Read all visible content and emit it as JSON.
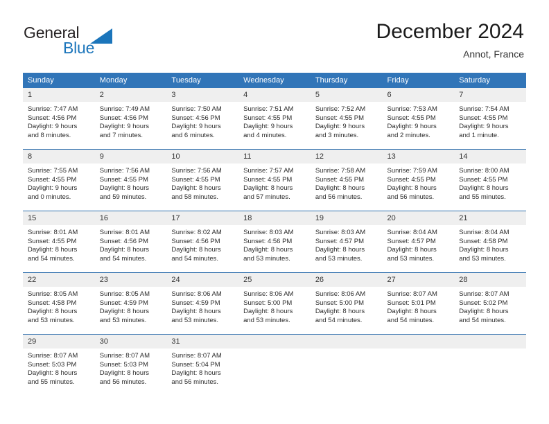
{
  "brand": {
    "word1": "General",
    "word2": "Blue",
    "colors": {
      "dark": "#231f20",
      "blue": "#1b75bb"
    },
    "triangle_icon": "triangle-icon"
  },
  "header": {
    "title": "December 2024",
    "subtitle": "Annot, France"
  },
  "theme": {
    "header_blue": "#3175b8",
    "row_divider": "#2f6fad",
    "daynum_background": "#efefef",
    "text": "#2b2b2b"
  },
  "weekdays": [
    "Sunday",
    "Monday",
    "Tuesday",
    "Wednesday",
    "Thursday",
    "Friday",
    "Saturday"
  ],
  "weeks": [
    [
      {
        "day": "1",
        "sunrise": "Sunrise: 7:47 AM",
        "sunset": "Sunset: 4:56 PM",
        "daylight1": "Daylight: 9 hours",
        "daylight2": "and 8 minutes."
      },
      {
        "day": "2",
        "sunrise": "Sunrise: 7:49 AM",
        "sunset": "Sunset: 4:56 PM",
        "daylight1": "Daylight: 9 hours",
        "daylight2": "and 7 minutes."
      },
      {
        "day": "3",
        "sunrise": "Sunrise: 7:50 AM",
        "sunset": "Sunset: 4:56 PM",
        "daylight1": "Daylight: 9 hours",
        "daylight2": "and 6 minutes."
      },
      {
        "day": "4",
        "sunrise": "Sunrise: 7:51 AM",
        "sunset": "Sunset: 4:55 PM",
        "daylight1": "Daylight: 9 hours",
        "daylight2": "and 4 minutes."
      },
      {
        "day": "5",
        "sunrise": "Sunrise: 7:52 AM",
        "sunset": "Sunset: 4:55 PM",
        "daylight1": "Daylight: 9 hours",
        "daylight2": "and 3 minutes."
      },
      {
        "day": "6",
        "sunrise": "Sunrise: 7:53 AM",
        "sunset": "Sunset: 4:55 PM",
        "daylight1": "Daylight: 9 hours",
        "daylight2": "and 2 minutes."
      },
      {
        "day": "7",
        "sunrise": "Sunrise: 7:54 AM",
        "sunset": "Sunset: 4:55 PM",
        "daylight1": "Daylight: 9 hours",
        "daylight2": "and 1 minute."
      }
    ],
    [
      {
        "day": "8",
        "sunrise": "Sunrise: 7:55 AM",
        "sunset": "Sunset: 4:55 PM",
        "daylight1": "Daylight: 9 hours",
        "daylight2": "and 0 minutes."
      },
      {
        "day": "9",
        "sunrise": "Sunrise: 7:56 AM",
        "sunset": "Sunset: 4:55 PM",
        "daylight1": "Daylight: 8 hours",
        "daylight2": "and 59 minutes."
      },
      {
        "day": "10",
        "sunrise": "Sunrise: 7:56 AM",
        "sunset": "Sunset: 4:55 PM",
        "daylight1": "Daylight: 8 hours",
        "daylight2": "and 58 minutes."
      },
      {
        "day": "11",
        "sunrise": "Sunrise: 7:57 AM",
        "sunset": "Sunset: 4:55 PM",
        "daylight1": "Daylight: 8 hours",
        "daylight2": "and 57 minutes."
      },
      {
        "day": "12",
        "sunrise": "Sunrise: 7:58 AM",
        "sunset": "Sunset: 4:55 PM",
        "daylight1": "Daylight: 8 hours",
        "daylight2": "and 56 minutes."
      },
      {
        "day": "13",
        "sunrise": "Sunrise: 7:59 AM",
        "sunset": "Sunset: 4:55 PM",
        "daylight1": "Daylight: 8 hours",
        "daylight2": "and 56 minutes."
      },
      {
        "day": "14",
        "sunrise": "Sunrise: 8:00 AM",
        "sunset": "Sunset: 4:55 PM",
        "daylight1": "Daylight: 8 hours",
        "daylight2": "and 55 minutes."
      }
    ],
    [
      {
        "day": "15",
        "sunrise": "Sunrise: 8:01 AM",
        "sunset": "Sunset: 4:55 PM",
        "daylight1": "Daylight: 8 hours",
        "daylight2": "and 54 minutes."
      },
      {
        "day": "16",
        "sunrise": "Sunrise: 8:01 AM",
        "sunset": "Sunset: 4:56 PM",
        "daylight1": "Daylight: 8 hours",
        "daylight2": "and 54 minutes."
      },
      {
        "day": "17",
        "sunrise": "Sunrise: 8:02 AM",
        "sunset": "Sunset: 4:56 PM",
        "daylight1": "Daylight: 8 hours",
        "daylight2": "and 54 minutes."
      },
      {
        "day": "18",
        "sunrise": "Sunrise: 8:03 AM",
        "sunset": "Sunset: 4:56 PM",
        "daylight1": "Daylight: 8 hours",
        "daylight2": "and 53 minutes."
      },
      {
        "day": "19",
        "sunrise": "Sunrise: 8:03 AM",
        "sunset": "Sunset: 4:57 PM",
        "daylight1": "Daylight: 8 hours",
        "daylight2": "and 53 minutes."
      },
      {
        "day": "20",
        "sunrise": "Sunrise: 8:04 AM",
        "sunset": "Sunset: 4:57 PM",
        "daylight1": "Daylight: 8 hours",
        "daylight2": "and 53 minutes."
      },
      {
        "day": "21",
        "sunrise": "Sunrise: 8:04 AM",
        "sunset": "Sunset: 4:58 PM",
        "daylight1": "Daylight: 8 hours",
        "daylight2": "and 53 minutes."
      }
    ],
    [
      {
        "day": "22",
        "sunrise": "Sunrise: 8:05 AM",
        "sunset": "Sunset: 4:58 PM",
        "daylight1": "Daylight: 8 hours",
        "daylight2": "and 53 minutes."
      },
      {
        "day": "23",
        "sunrise": "Sunrise: 8:05 AM",
        "sunset": "Sunset: 4:59 PM",
        "daylight1": "Daylight: 8 hours",
        "daylight2": "and 53 minutes."
      },
      {
        "day": "24",
        "sunrise": "Sunrise: 8:06 AM",
        "sunset": "Sunset: 4:59 PM",
        "daylight1": "Daylight: 8 hours",
        "daylight2": "and 53 minutes."
      },
      {
        "day": "25",
        "sunrise": "Sunrise: 8:06 AM",
        "sunset": "Sunset: 5:00 PM",
        "daylight1": "Daylight: 8 hours",
        "daylight2": "and 53 minutes."
      },
      {
        "day": "26",
        "sunrise": "Sunrise: 8:06 AM",
        "sunset": "Sunset: 5:00 PM",
        "daylight1": "Daylight: 8 hours",
        "daylight2": "and 54 minutes."
      },
      {
        "day": "27",
        "sunrise": "Sunrise: 8:07 AM",
        "sunset": "Sunset: 5:01 PM",
        "daylight1": "Daylight: 8 hours",
        "daylight2": "and 54 minutes."
      },
      {
        "day": "28",
        "sunrise": "Sunrise: 8:07 AM",
        "sunset": "Sunset: 5:02 PM",
        "daylight1": "Daylight: 8 hours",
        "daylight2": "and 54 minutes."
      }
    ],
    [
      {
        "day": "29",
        "sunrise": "Sunrise: 8:07 AM",
        "sunset": "Sunset: 5:03 PM",
        "daylight1": "Daylight: 8 hours",
        "daylight2": "and 55 minutes."
      },
      {
        "day": "30",
        "sunrise": "Sunrise: 8:07 AM",
        "sunset": "Sunset: 5:03 PM",
        "daylight1": "Daylight: 8 hours",
        "daylight2": "and 56 minutes."
      },
      {
        "day": "31",
        "sunrise": "Sunrise: 8:07 AM",
        "sunset": "Sunset: 5:04 PM",
        "daylight1": "Daylight: 8 hours",
        "daylight2": "and 56 minutes."
      },
      {
        "day": "",
        "sunrise": "",
        "sunset": "",
        "daylight1": "",
        "daylight2": ""
      },
      {
        "day": "",
        "sunrise": "",
        "sunset": "",
        "daylight1": "",
        "daylight2": ""
      },
      {
        "day": "",
        "sunrise": "",
        "sunset": "",
        "daylight1": "",
        "daylight2": ""
      },
      {
        "day": "",
        "sunrise": "",
        "sunset": "",
        "daylight1": "",
        "daylight2": ""
      }
    ]
  ]
}
